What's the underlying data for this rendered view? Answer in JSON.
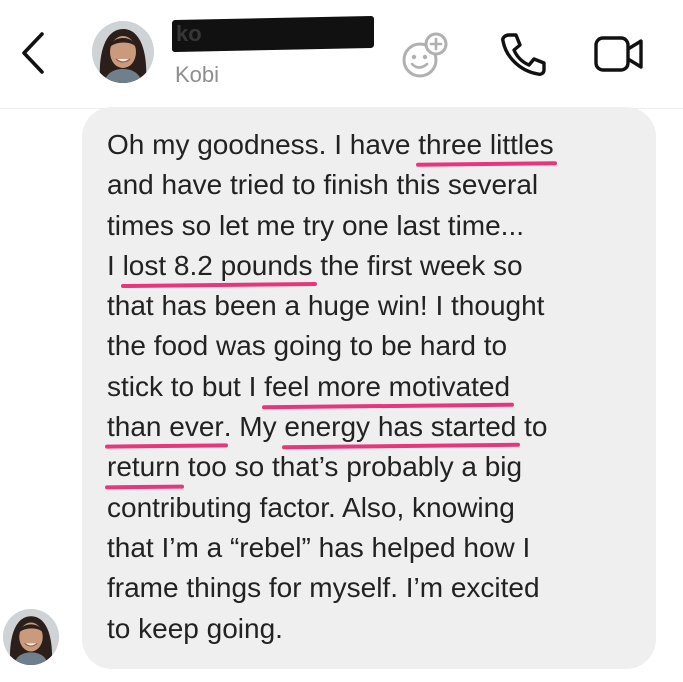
{
  "header": {
    "back_icon": "chevron-left-icon",
    "contact_redacted_fragment": "ko",
    "contact_name": "Kobi",
    "effects_icon": "sticker-effects-icon",
    "call_icon": "phone-icon",
    "video_icon": "video-camera-icon"
  },
  "message": {
    "highlight_color": "#e8367c",
    "bubble_color": "#efefef",
    "lines": [
      [
        {
          "t": "Oh my goodness. I have "
        },
        {
          "t": "three littles",
          "hl": true
        }
      ],
      [
        {
          "t": "and have tried to finish this several"
        }
      ],
      [
        {
          "t": "times so let me try one last time..."
        }
      ],
      [
        {
          "t": "I "
        },
        {
          "t": "lost 8.2 pounds",
          "hl": true
        },
        {
          "t": " the first week so"
        }
      ],
      [
        {
          "t": "that has been a huge win! I thought"
        }
      ],
      [
        {
          "t": "the food was going to be hard to"
        }
      ],
      [
        {
          "t": "stick to but I "
        },
        {
          "t": "feel more motivated",
          "hl": true
        }
      ],
      [
        {
          "t": "than ever",
          "hl": true
        },
        {
          "t": ". My "
        },
        {
          "t": "energy has started",
          "hl": true
        },
        {
          "t": " to"
        }
      ],
      [
        {
          "t": "return",
          "hl": true
        },
        {
          "t": " too so that’s probably a big"
        }
      ],
      [
        {
          "t": "contributing factor. Also, knowing"
        }
      ],
      [
        {
          "t": "that I’m a “rebel” has helped how I"
        }
      ],
      [
        {
          "t": "frame things for myself. I’m excited"
        }
      ],
      [
        {
          "t": "to keep going."
        }
      ]
    ]
  }
}
